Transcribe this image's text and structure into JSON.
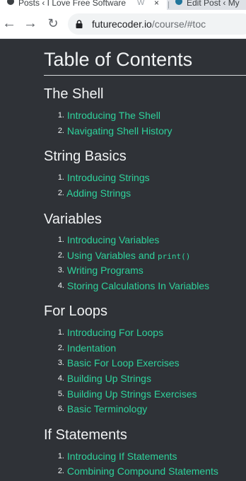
{
  "browser": {
    "tabs": [
      {
        "title": "Posts ‹ I Love Free Software",
        "close": "×",
        "fade": "W"
      },
      {
        "title": "Edit Post ‹ My"
      }
    ],
    "url_host": "futurecoder.io",
    "url_path": "/course/#toc",
    "nav": {
      "back": "←",
      "forward": "→",
      "reload": "↻"
    }
  },
  "page": {
    "title": "Table of Contents",
    "sections": [
      {
        "heading": "The Shell",
        "items": [
          {
            "num": "1.",
            "label": "Introducing The Shell"
          },
          {
            "num": "2.",
            "label": "Navigating Shell History"
          }
        ]
      },
      {
        "heading": "String Basics",
        "items": [
          {
            "num": "1.",
            "label": "Introducing Strings"
          },
          {
            "num": "2.",
            "label": "Adding Strings"
          }
        ]
      },
      {
        "heading": "Variables",
        "items": [
          {
            "num": "1.",
            "label": "Introducing Variables"
          },
          {
            "num": "2.",
            "label": "Using Variables and ",
            "code": "print()"
          },
          {
            "num": "3.",
            "label": "Writing Programs"
          },
          {
            "num": "4.",
            "label": "Storing Calculations In Variables"
          }
        ]
      },
      {
        "heading": "For Loops",
        "items": [
          {
            "num": "1.",
            "label": "Introducing For Loops"
          },
          {
            "num": "2.",
            "label": "Indentation"
          },
          {
            "num": "3.",
            "label": "Basic For Loop Exercises"
          },
          {
            "num": "4.",
            "label": "Building Up Strings"
          },
          {
            "num": "5.",
            "label": "Building Up Strings Exercises"
          },
          {
            "num": "6.",
            "label": "Basic Terminology"
          }
        ]
      },
      {
        "heading": "If Statements",
        "items": [
          {
            "num": "1.",
            "label": "Introducing If Statements"
          },
          {
            "num": "2.",
            "label": "Combining Compound Statements"
          }
        ]
      }
    ]
  },
  "colors": {
    "background": "#2f3237",
    "link": "#2fd29c",
    "heading": "#f1f3f4"
  }
}
